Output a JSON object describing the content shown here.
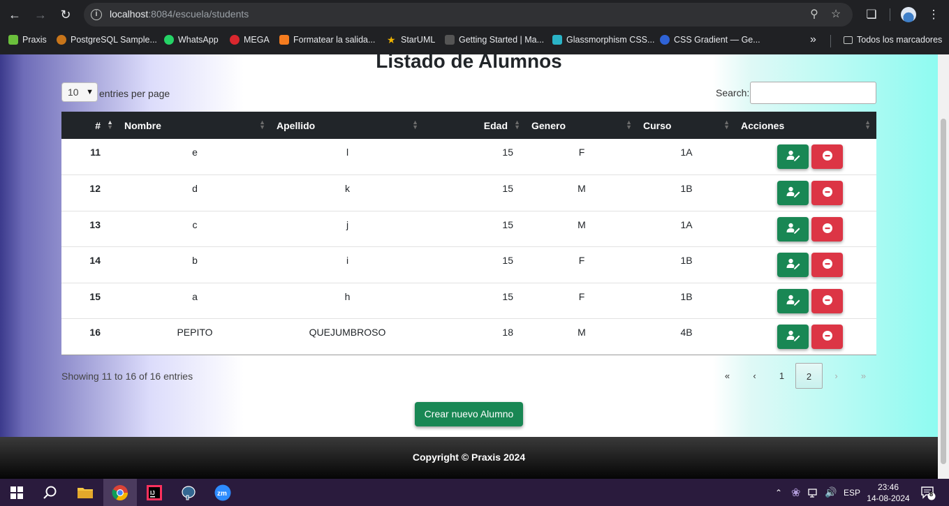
{
  "browser": {
    "url_host": "localhost",
    "url_rest": ":8084/escuela/students"
  },
  "bookmarks": {
    "items": [
      {
        "label": "Praxis",
        "icon": "praxis-icon",
        "color": "#6bbf3c"
      },
      {
        "label": "PostgreSQL Sample...",
        "icon": "postgres-sample-icon",
        "color": "#c8751a"
      },
      {
        "label": "WhatsApp",
        "icon": "whatsapp-icon",
        "color": "#25d366"
      },
      {
        "label": "MEGA",
        "icon": "mega-icon",
        "color": "#d9272e"
      },
      {
        "label": "Formatear la salida...",
        "icon": "format-icon",
        "color": "#f57c1f"
      },
      {
        "label": "StarUML",
        "icon": "staruml-icon",
        "color": "#f0b400"
      },
      {
        "label": "Getting Started | Ma...",
        "icon": "markdown-icon",
        "color": "#555555"
      },
      {
        "label": "Glassmorphism CSS...",
        "icon": "glass-icon",
        "color": "#2ab3c6"
      },
      {
        "label": "CSS Gradient — Ge...",
        "icon": "gradient-icon",
        "color": "#2f63d6"
      }
    ],
    "overflow": "»",
    "all_bookmarks": "Todos los marcadores"
  },
  "page": {
    "title": "Listado de Alumnos",
    "length_value": "10",
    "length_label": "entries per page",
    "search_label": "Search:",
    "columns": [
      "#",
      "Nombre",
      "Apellido",
      "Edad",
      "Genero",
      "Curso",
      "Acciones"
    ],
    "rows": [
      {
        "id": "11",
        "nombre": "e",
        "apellido": "l",
        "edad": "15",
        "genero": "F",
        "curso": "1A"
      },
      {
        "id": "12",
        "nombre": "d",
        "apellido": "k",
        "edad": "15",
        "genero": "M",
        "curso": "1B"
      },
      {
        "id": "13",
        "nombre": "c",
        "apellido": "j",
        "edad": "15",
        "genero": "M",
        "curso": "1A"
      },
      {
        "id": "14",
        "nombre": "b",
        "apellido": "i",
        "edad": "15",
        "genero": "F",
        "curso": "1B"
      },
      {
        "id": "15",
        "nombre": "a",
        "apellido": "h",
        "edad": "15",
        "genero": "F",
        "curso": "1B"
      },
      {
        "id": "16",
        "nombre": "PEPITO",
        "apellido": "QUEJUMBROSO",
        "edad": "18",
        "genero": "M",
        "curso": "4B"
      }
    ],
    "info": "Showing 11 to 16 of 16 entries",
    "pagination": {
      "first": "«",
      "prev": "‹",
      "pages": [
        "1",
        "2"
      ],
      "current": "2",
      "next": "›",
      "last": "»"
    },
    "create_button": "Crear nuevo Alumno",
    "footer": "Copyright © Praxis 2024"
  },
  "taskbar": {
    "language": "ESP",
    "time": "23:46",
    "date": "14-08-2024",
    "notifications": "8"
  },
  "colors": {
    "success": "#198754",
    "danger": "#dc3545",
    "table_header": "#212529"
  }
}
